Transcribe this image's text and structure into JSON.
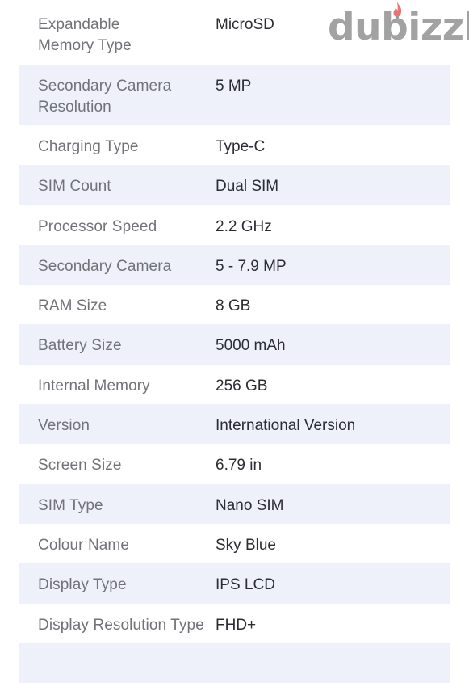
{
  "brand": {
    "name": "dubizzle",
    "text_color": "#9b9b9b",
    "flame_color": "#e8736f"
  },
  "specs": [
    {
      "label": "Expandable Memory Type",
      "value": "MicroSD"
    },
    {
      "label": "Secondary Camera Resolution",
      "value": "5 MP"
    },
    {
      "label": "Charging Type",
      "value": "Type-C"
    },
    {
      "label": "SIM Count",
      "value": "Dual SIM"
    },
    {
      "label": "Processor Speed",
      "value": "2.2 GHz"
    },
    {
      "label": "Secondary Camera",
      "value": "5 - 7.9 MP"
    },
    {
      "label": "RAM Size",
      "value": "8 GB"
    },
    {
      "label": "Battery Size",
      "value": "5000 mAh"
    },
    {
      "label": "Internal Memory",
      "value": "256 GB"
    },
    {
      "label": "Version",
      "value": "International Version"
    },
    {
      "label": "Screen Size",
      "value": "6.79 in"
    },
    {
      "label": "SIM Type",
      "value": "Nano SIM"
    },
    {
      "label": "Colour Name",
      "value": "Sky Blue"
    },
    {
      "label": "Display Type",
      "value": "IPS LCD"
    },
    {
      "label": "Display Resolution Type",
      "value": "FHD+"
    }
  ]
}
